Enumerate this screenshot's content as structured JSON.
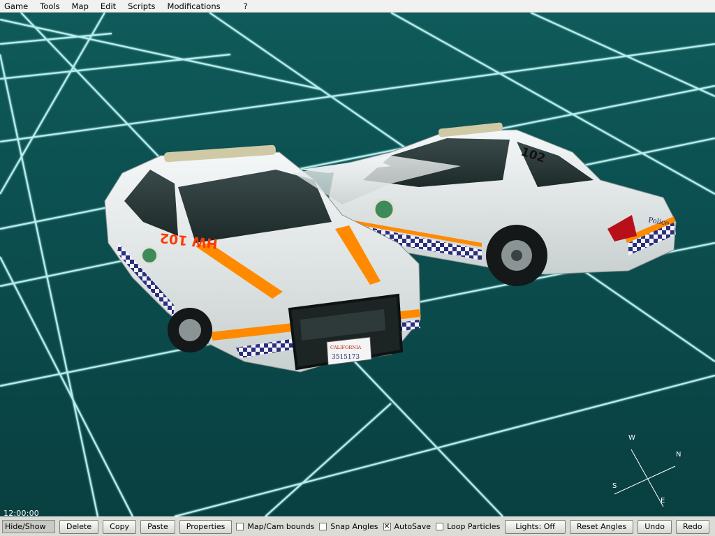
{
  "menu": [
    "Game",
    "Tools",
    "Map",
    "Edit",
    "Scripts",
    "Modifications",
    "?"
  ],
  "viewport": {
    "time": "12:00:00",
    "compass": {
      "n": "N",
      "s": "S",
      "e": "E",
      "w": "W"
    },
    "car_front": {
      "hood_text": "HW 102",
      "plate_state": "CALIFORNIA",
      "plate_number": "3515173"
    },
    "car_rear": {
      "roof_number": "102",
      "trunk_text": "Police"
    }
  },
  "toolbar": {
    "hide_show": "Hide/Show",
    "buttons": [
      "Delete",
      "Copy",
      "Paste",
      "Properties"
    ],
    "checks": [
      {
        "label": "Map/Cam bounds",
        "checked": false
      },
      {
        "label": "Snap Angles",
        "checked": false
      },
      {
        "label": "AutoSave",
        "checked": true
      },
      {
        "label": "Loop Particles",
        "checked": false
      }
    ],
    "right_buttons": [
      "Lights: Off",
      "Reset Angles",
      "Undo",
      "Redo"
    ]
  },
  "colors": {
    "sky": "#0f5a5a",
    "grid": "#c9ffff",
    "car_body": "#e8ecec",
    "accent_orange": "#ff8a00",
    "toolbar_bg": "#dcdcd6"
  }
}
